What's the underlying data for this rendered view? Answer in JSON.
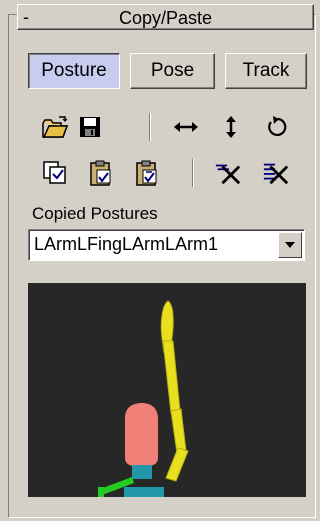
{
  "header": {
    "collapse_symbol": "-",
    "title": "Copy/Paste"
  },
  "mode_tabs": [
    {
      "label": "Posture",
      "active": true
    },
    {
      "label": "Pose",
      "active": false
    },
    {
      "label": "Track",
      "active": false
    }
  ],
  "toolbar_row1": [
    {
      "icon": "open-folder-icon"
    },
    {
      "icon": "save-disk-icon"
    },
    {
      "icon": "mirror-horizontal-icon"
    },
    {
      "icon": "mirror-vertical-icon"
    },
    {
      "icon": "rotate-icon"
    }
  ],
  "toolbar_row2": [
    {
      "icon": "copy-posture-icon"
    },
    {
      "icon": "paste-posture-icon"
    },
    {
      "icon": "paste-opposite-icon"
    },
    {
      "icon": "delete-selected-icon"
    },
    {
      "icon": "delete-all-icon"
    }
  ],
  "copied_postures": {
    "label": "Copied Postures",
    "selected": "LArmLFingLArmLArm1"
  },
  "colors": {
    "panel_bg": "#d4d0c8",
    "active_tab": "#c8cdf0",
    "preview_bg": "#272727",
    "arm_yellow": "#e8e01e",
    "head_red": "#f08078",
    "leg_green": "#22cc22",
    "pelvis_teal": "#2299aa",
    "icon_blue": "#000080"
  }
}
